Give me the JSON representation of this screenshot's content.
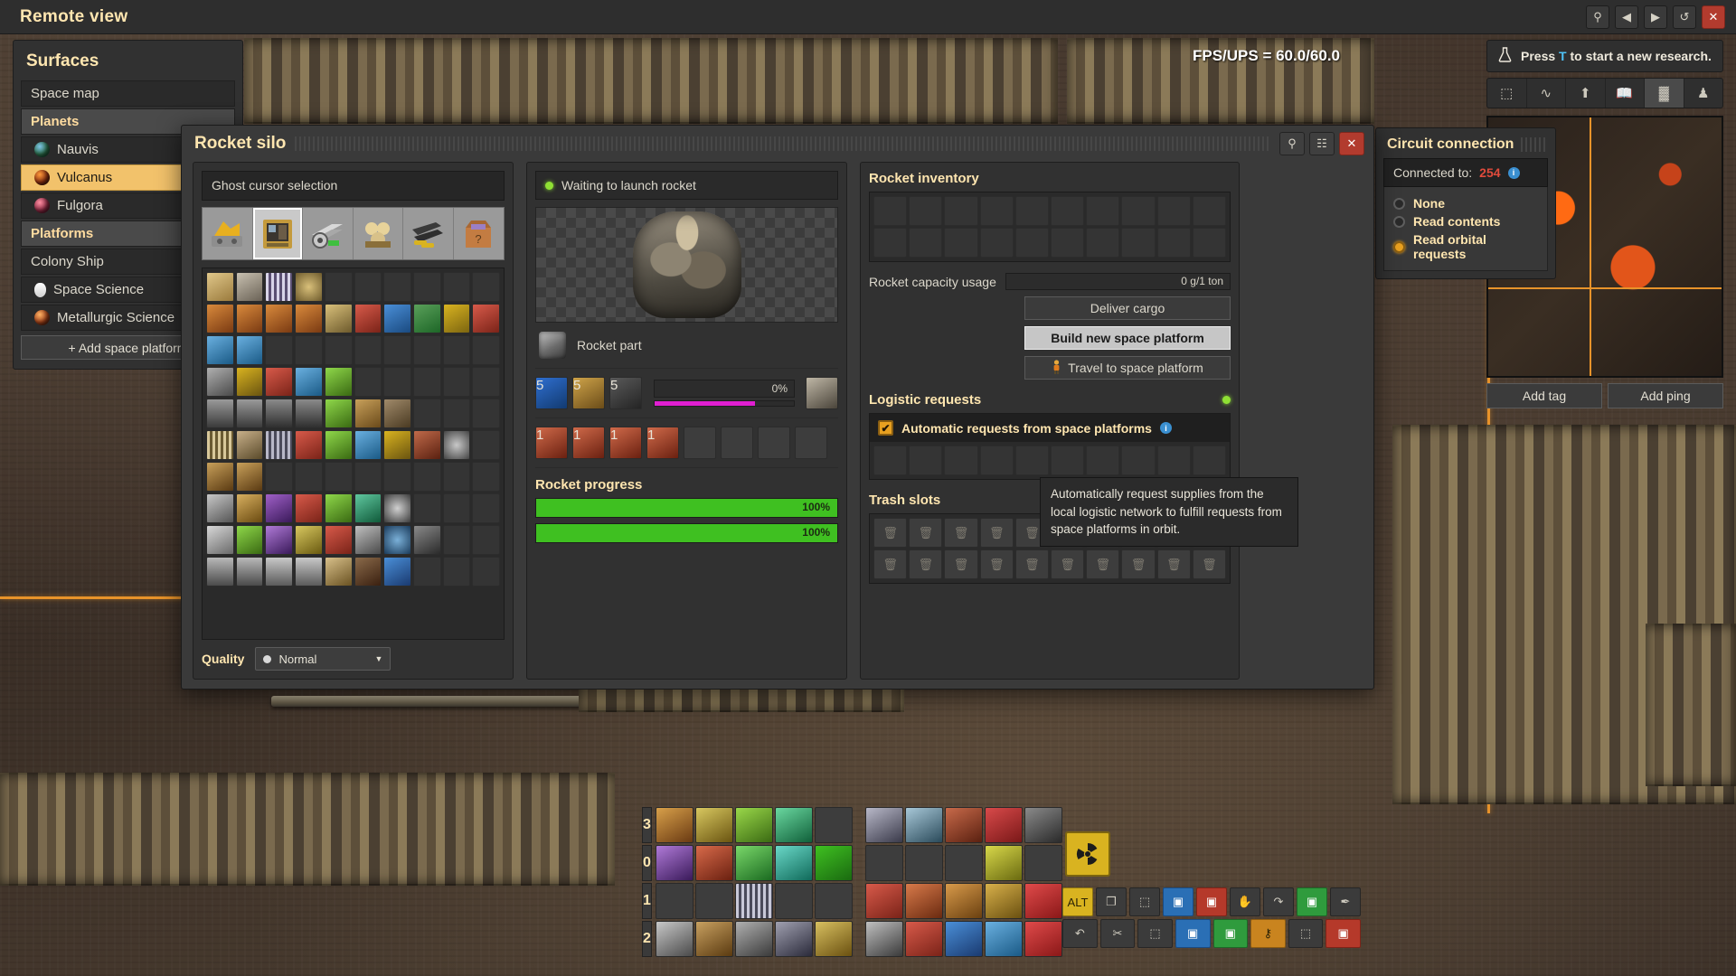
{
  "topbar": {
    "title": "Remote view",
    "buttons": [
      {
        "name": "search-icon",
        "glyph": "⚲"
      },
      {
        "name": "prev-icon",
        "glyph": "◀"
      },
      {
        "name": "next-icon",
        "glyph": "▶"
      },
      {
        "name": "refresh-icon",
        "glyph": "↺"
      },
      {
        "name": "close-icon",
        "glyph": "✕"
      }
    ]
  },
  "surfaces": {
    "title": "Surfaces",
    "items": [
      {
        "label": "Space map",
        "type": "item",
        "icon": "none"
      },
      {
        "label": "Planets",
        "type": "group",
        "icon": "none"
      },
      {
        "label": "Nauvis",
        "type": "item",
        "icon": "planet-nauvis"
      },
      {
        "label": "Vulcanus",
        "type": "item",
        "icon": "planet-vulcanus",
        "selected": true
      },
      {
        "label": "Fulgora",
        "type": "item",
        "icon": "planet-fulgora"
      },
      {
        "label": "Platforms",
        "type": "group",
        "icon": "none"
      },
      {
        "label": "Colony Ship",
        "type": "item",
        "icon": "none"
      },
      {
        "label": "Space Science",
        "type": "item",
        "icon": "flask"
      },
      {
        "label": "Metallurgic Science",
        "type": "item",
        "icon": "metal"
      }
    ],
    "add_button": "+ Add space platform"
  },
  "hud": {
    "fps_label": "FPS/UPS = 60.0/60.0"
  },
  "research": {
    "prompt_prefix": "Press ",
    "prompt_key": "T",
    "prompt_suffix": " to start a new research.",
    "flask_icon": "flask-icon",
    "icons": [
      {
        "name": "select-area-icon",
        "glyph": "⬚"
      },
      {
        "name": "production-graph-icon",
        "glyph": "∿"
      },
      {
        "name": "logistics-icon",
        "glyph": "⬆"
      },
      {
        "name": "tips-book-icon",
        "glyph": "📖"
      },
      {
        "name": "trains-icon",
        "glyph": "▓",
        "active": true
      },
      {
        "name": "achievements-icon",
        "glyph": "♟"
      }
    ]
  },
  "map": {
    "add_tag": "Add tag",
    "add_ping": "Add ping"
  },
  "circuit": {
    "title": "Circuit connection",
    "connected_label": "Connected to:",
    "connected_value": "254",
    "connected_color": "#e04b3c",
    "info_icon": "info-icon",
    "options": [
      {
        "label": "None",
        "selected": false
      },
      {
        "label": "Read contents",
        "selected": false
      },
      {
        "label": "Read orbital requests",
        "selected": true
      }
    ]
  },
  "silo": {
    "title": "Rocket silo",
    "header_buttons": [
      {
        "name": "search-icon",
        "glyph": "⚲"
      },
      {
        "name": "blueprint-icon",
        "glyph": "☷"
      },
      {
        "name": "close-icon",
        "glyph": "✕"
      }
    ],
    "ghost": {
      "header": "Ghost cursor selection",
      "quickbar": [
        {
          "name": "ghost-slot-assembler",
          "selected": false
        },
        {
          "name": "ghost-slot-rocket-silo",
          "selected": true
        },
        {
          "name": "ghost-slot-steel-gear",
          "selected": false
        },
        {
          "name": "ghost-slot-processing-unit",
          "selected": false
        },
        {
          "name": "ghost-slot-weapons",
          "selected": false
        },
        {
          "name": "ghost-slot-misc-box",
          "selected": false
        }
      ],
      "quality_label": "Quality",
      "quality_value": "Normal"
    },
    "center": {
      "status": "Waiting to launch rocket",
      "status_led_color": "#8fe034",
      "item_name": "Rocket part",
      "ingredients": [
        {
          "name": "low-density-structure",
          "count": "5"
        },
        {
          "name": "rocket-fuel",
          "count": "5"
        },
        {
          "name": "processing-unit",
          "count": "5"
        }
      ],
      "craft_progress_label": "0%",
      "craft_progress_pct": 72,
      "output_items": [
        {
          "name": "rocket-part",
          "count": "1"
        },
        {
          "name": "rocket-part",
          "count": "1"
        },
        {
          "name": "rocket-part",
          "count": "1"
        },
        {
          "name": "rocket-part",
          "count": "1"
        }
      ],
      "progress_title": "Rocket progress",
      "bars": [
        {
          "label": "100%",
          "pct": 100
        },
        {
          "label": "100%",
          "pct": 100
        }
      ]
    },
    "right": {
      "inventory_title": "Rocket inventory",
      "capacity_label": "Rocket capacity usage",
      "capacity_value": "0 g/1 ton",
      "capacity_pct": 0,
      "buttons": [
        {
          "label": "Deliver cargo",
          "style": "normal",
          "icon": "none"
        },
        {
          "label": "Build new space platform",
          "style": "highlight",
          "icon": "none"
        },
        {
          "label": "Travel to space platform",
          "style": "normal",
          "icon": "character-icon"
        }
      ],
      "logistic_title": "Logistic requests",
      "logistic_led_color": "#8fe034",
      "auto_request_label": "Automatic requests from space platforms",
      "auto_request_checked": true,
      "trash_title": "Trash slots"
    }
  },
  "tooltip": {
    "text": "Automatically request supplies from the local logistic network to fulfill requests from space platforms in orbit."
  },
  "hotbar": {
    "rows": [
      {
        "number": "3"
      },
      {
        "number": "0"
      },
      {
        "number": "1"
      },
      {
        "number": "2"
      }
    ]
  },
  "toolgrid": {
    "row1": [
      {
        "label": "ALT",
        "style": "y",
        "name": "alt-mode-button"
      },
      {
        "label": "❐",
        "style": "",
        "name": "copy-button"
      },
      {
        "label": "⬚",
        "style": "",
        "name": "select-button"
      },
      {
        "label": "▣",
        "style": "b",
        "name": "blueprint-button"
      },
      {
        "label": "▣",
        "style": "r",
        "name": "deconstruction-planner-button"
      },
      {
        "label": "✋",
        "style": "",
        "name": "upgrade-planner-button"
      },
      {
        "label": "↷",
        "style": "",
        "name": "undo-button"
      },
      {
        "label": "▣",
        "style": "g",
        "name": "blueprint-book-button"
      },
      {
        "label": "✒",
        "style": "",
        "name": "cut-button"
      }
    ],
    "row2": [
      {
        "label": "↶",
        "style": "",
        "name": "undo-arrow-button"
      },
      {
        "label": "✂",
        "style": "",
        "name": "scissors-button"
      },
      {
        "label": "⬚",
        "style": "",
        "name": "select-dashed-button"
      },
      {
        "label": "▣",
        "style": "b",
        "name": "blueprint2-button"
      },
      {
        "label": "▣",
        "style": "g",
        "name": "green-tool-button"
      },
      {
        "label": "⚷",
        "style": "o",
        "name": "pipette-button"
      },
      {
        "label": "⬚",
        "style": "",
        "name": "area-tool-button"
      },
      {
        "label": "▣",
        "style": "r",
        "name": "red-tool-button"
      }
    ]
  }
}
